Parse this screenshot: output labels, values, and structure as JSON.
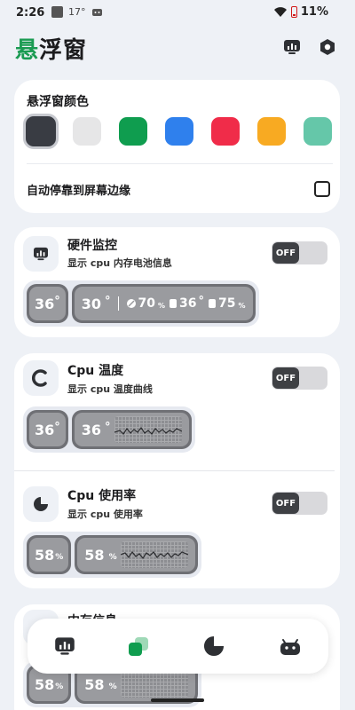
{
  "status": {
    "time": "2:26",
    "temp": "17°",
    "battery": "11%"
  },
  "header": {
    "title_accent": "悬",
    "title_rest": "浮窗"
  },
  "color_section": {
    "title": "悬浮窗颜色",
    "swatches": [
      "#393c43",
      "#e6e6e7",
      "#0f9d4f",
      "#2f80ed",
      "#f02c49",
      "#f8aa22",
      "#65c7a9"
    ],
    "selected_index": 0
  },
  "edge": {
    "label": "自动停靠到屏幕边缘",
    "checked": false
  },
  "hardware": {
    "title": "硬件监控",
    "subtitle": "显示 cpu 内存电池信息",
    "toggle": "OFF",
    "preview": {
      "temp": "36",
      "temp2": "30",
      "mem": "70",
      "pct_unit": "%",
      "batt_temp": "36",
      "batt": "75"
    }
  },
  "cpu_temp": {
    "title": "Cpu 温度",
    "subtitle": "显示 cpu 温度曲线",
    "toggle": "OFF",
    "preview": {
      "temp": "36",
      "temp_wide": "36"
    }
  },
  "cpu_usage": {
    "title": "Cpu 使用率",
    "subtitle": "显示 cpu 使用率",
    "toggle": "OFF",
    "preview": {
      "usage": "58",
      "usage_wide": "58",
      "unit": "%"
    }
  },
  "memory": {
    "title": "内存信息",
    "preview": {
      "usage": "58",
      "usage_wide": "58",
      "unit": "%"
    }
  },
  "nav": {
    "items": [
      "monitor-icon",
      "window-icon",
      "pie-chart-icon",
      "android-icon"
    ],
    "active_index": 1
  }
}
